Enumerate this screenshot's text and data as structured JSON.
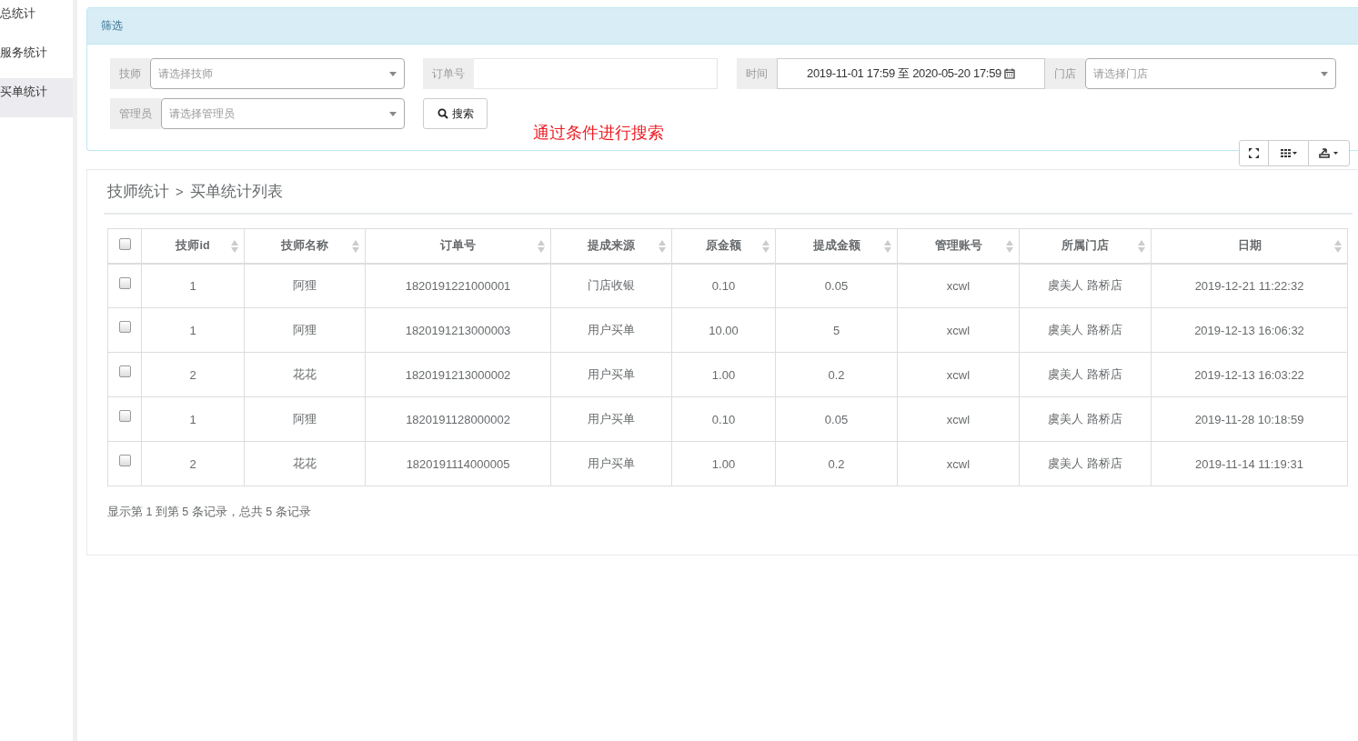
{
  "sidebar": {
    "items": [
      {
        "label": "总统计",
        "selected": false
      },
      {
        "label": "服务统计",
        "selected": false
      },
      {
        "label": "买单统计",
        "selected": true
      }
    ]
  },
  "filter": {
    "title": "筛选",
    "technician": {
      "label": "技师",
      "placeholder": "请选择技师"
    },
    "order_no": {
      "label": "订单号"
    },
    "time": {
      "label": "时间",
      "value": "2019-11-01 17:59 至 2020-05-20 17:59"
    },
    "store": {
      "label": "门店",
      "placeholder": "请选择门店"
    },
    "manager": {
      "label": "管理员",
      "placeholder": "请选择管理员"
    },
    "search_button": "搜索",
    "annotation": "通过条件进行搜索"
  },
  "breadcrumb": {
    "parent": "技师统计",
    "separator": ">",
    "current": "买单统计列表"
  },
  "table": {
    "select_all_checked": false,
    "columns": [
      "技师id",
      "技师名称",
      "订单号",
      "提成来源",
      "原金额",
      "提成金额",
      "管理账号",
      "所属门店",
      "日期"
    ],
    "rows": [
      {
        "checked": false,
        "cells": [
          "1",
          "阿狸",
          "1820191221000001",
          "门店收银",
          "0.10",
          "0.05",
          "xcwl",
          "虞美人 路桥店",
          "2019-12-21 11:22:32"
        ]
      },
      {
        "checked": false,
        "cells": [
          "1",
          "阿狸",
          "1820191213000003",
          "用户买单",
          "10.00",
          "5",
          "xcwl",
          "虞美人 路桥店",
          "2019-12-13 16:06:32"
        ]
      },
      {
        "checked": false,
        "cells": [
          "2",
          "花花",
          "1820191213000002",
          "用户买单",
          "1.00",
          "0.2",
          "xcwl",
          "虞美人 路桥店",
          "2019-12-13 16:03:22"
        ]
      },
      {
        "checked": false,
        "cells": [
          "1",
          "阿狸",
          "1820191128000002",
          "用户买单",
          "0.10",
          "0.05",
          "xcwl",
          "虞美人 路桥店",
          "2019-11-28 10:18:59"
        ]
      },
      {
        "checked": false,
        "cells": [
          "2",
          "花花",
          "1820191114000005",
          "用户买单",
          "1.00",
          "0.2",
          "xcwl",
          "虞美人 路桥店",
          "2019-11-14 11:19:31"
        ]
      }
    ]
  },
  "pagination_info": "显示第 1 到第 5 条记录，总共 5 条记录"
}
